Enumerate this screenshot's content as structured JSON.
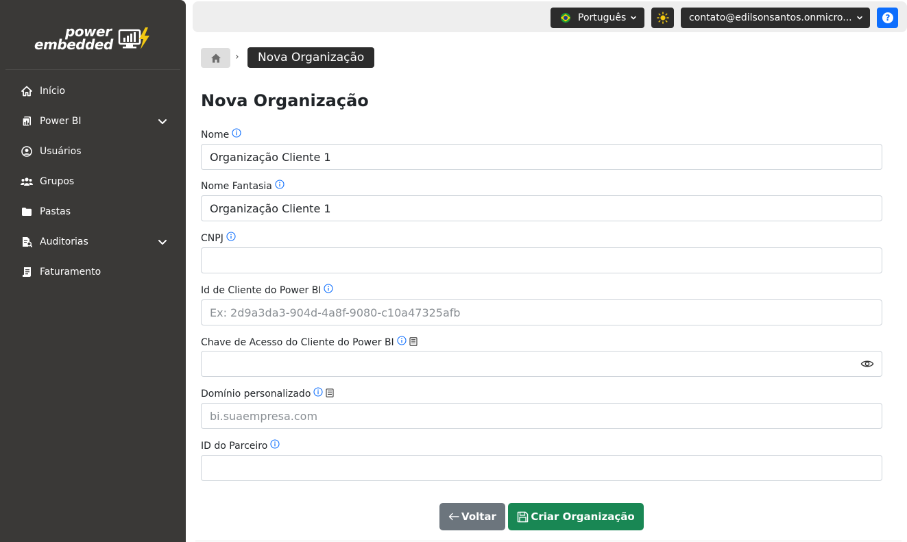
{
  "sidebar": {
    "logo": {
      "line1": "power",
      "line2": "embedded"
    },
    "items": [
      {
        "label": "Início",
        "icon": "home-icon"
      },
      {
        "label": "Power BI",
        "icon": "report-icon",
        "expandable": true
      },
      {
        "label": "Usuários",
        "icon": "user-circle-icon"
      },
      {
        "label": "Grupos",
        "icon": "users-icon"
      },
      {
        "label": "Pastas",
        "icon": "folder-icon"
      },
      {
        "label": "Auditorias",
        "icon": "audit-icon",
        "expandable": true
      },
      {
        "label": "Faturamento",
        "icon": "invoice-icon"
      }
    ]
  },
  "topbar": {
    "language": "Português",
    "language_flag": "brazil-flag-icon",
    "theme_icon": "sun-icon",
    "account": "contato@edilsonsantos.onmicro...",
    "help_icon": "question-icon"
  },
  "breadcrumb": {
    "current": "Nova Organização",
    "home_icon": "home-icon"
  },
  "page": {
    "title": "Nova Organização"
  },
  "form": {
    "nome": {
      "label": "Nome",
      "value": "Organização Cliente 1",
      "placeholder": ""
    },
    "nome_fantasia": {
      "label": "Nome Fantasia",
      "value": "Organização Cliente 1",
      "placeholder": ""
    },
    "cnpj": {
      "label": "CNPJ",
      "value": "",
      "placeholder": ""
    },
    "client_id": {
      "label": "Id de Cliente do Power BI",
      "value": "",
      "placeholder": "Ex: 2d9a3da3-904d-4a8f-9080-c10a47325afb"
    },
    "client_secret": {
      "label": "Chave de Acesso do Cliente do Power BI",
      "value": "",
      "placeholder": ""
    },
    "dominio": {
      "label": "Domínio personalizado",
      "value": "",
      "placeholder": "bi.suaempresa.com"
    },
    "parceiro": {
      "label": "ID do Parceiro",
      "value": "",
      "placeholder": ""
    }
  },
  "actions": {
    "back": "Voltar",
    "create": "Criar Organização"
  },
  "colors": {
    "sidebar": "#3a3937",
    "primary": "#0d6efd",
    "success": "#198754",
    "secondary": "#6c757d",
    "dark": "#2c2c2c"
  }
}
